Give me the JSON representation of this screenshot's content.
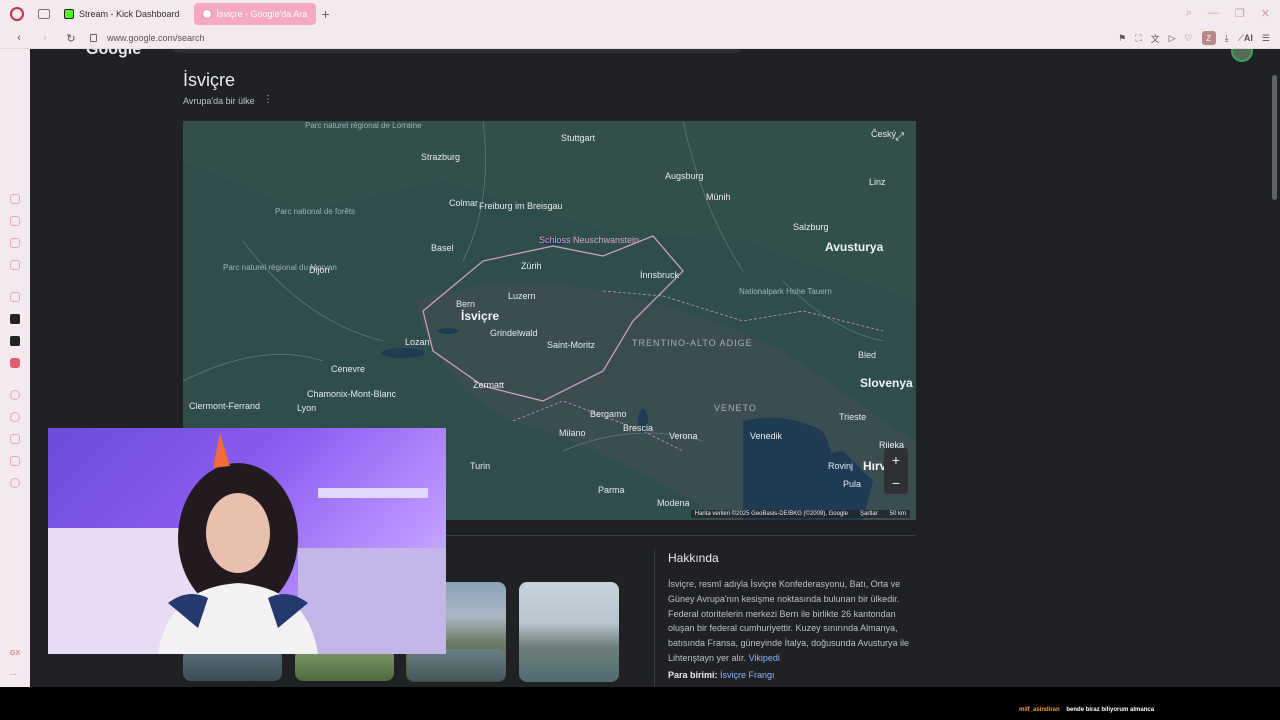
{
  "browser": {
    "tabs": [
      {
        "label": "Stream - Kick Dashboard"
      },
      {
        "label": "İsviçre - Google'da Ara"
      }
    ],
    "url": "www.google.com/search",
    "profile_letter": "Z",
    "ai_label": "AI"
  },
  "google": {
    "logo": "Google"
  },
  "knowledge_panel": {
    "title": "İsviçre",
    "subtitle": "Avrupa'da bir ülke",
    "about_heading": "Hakkında",
    "about_text": "İsviçre, resmî adıyla İsviçre Konfederasyonu, Batı, Orta ve Güney Avrupa'nın kesişme noktasında bulunan bir ülkedir. Federal otoritelerin merkezi Bern ile birlikte 26 kantondan oluşan bir federal cumhuriyettir. Kuzey sınırında Almanya, batısında Fransa, güneyinde İtalya, doğusunda Avusturya ile Lihtenştayn yer alır.",
    "about_link": "Vikipedi",
    "currency_label": "Para birimi:",
    "currency_value": "İsviçre Frangı"
  },
  "map": {
    "country_label": "İsviçre",
    "countries": [
      "Avusturya",
      "Slovenya",
      "Hırvat"
    ],
    "cities": [
      "Stuttgart",
      "Strazburg",
      "Augsburg",
      "Münih",
      "Freiburg im Breisgau",
      "Colmar",
      "Linz",
      "Salzburg",
      "Basel",
      "Zürih",
      "İnnsbruck",
      "Dijon",
      "Bern",
      "Luzern",
      "Grindelwald",
      "Lozan",
      "Saint-Moritz",
      "Bled",
      "Cenevre",
      "Chamonix-Mont-Blanc",
      "Zermatt",
      "Bergamo",
      "Brescia",
      "Trieste",
      "Clermont-Ferrand",
      "Lyon",
      "Milano",
      "Verona",
      "Venedik",
      "Rijeka",
      "Turin",
      "Parma",
      "Modena",
      "Rovinj",
      "Pula",
      "Český"
    ],
    "poi": "Schloss Neuschwanstein",
    "regions": [
      "TRENTINO-ALTO ADIGE",
      "VENETO"
    ],
    "parks": [
      "Parc naturel régional de Lorraine",
      "Parc national de forêts",
      "Parc naturel régional du Morvan",
      "Nationalpark Hohe Tauern"
    ],
    "attribution": "Harita verileri ©2025 GeoBasis-DE/BKG (©2009), Google",
    "terms": "Şartlar",
    "scale": "50 km",
    "zoom_in": "+",
    "zoom_out": "−"
  },
  "stream_chat": {
    "user": "milf_asindiran",
    "message": "bende biraz biliyorum almanca"
  },
  "colors": {
    "page_bg": "#202124",
    "map_bg": "#2f4f4f",
    "link": "#8ab4f8",
    "tab_active": "#f4a8c4"
  }
}
